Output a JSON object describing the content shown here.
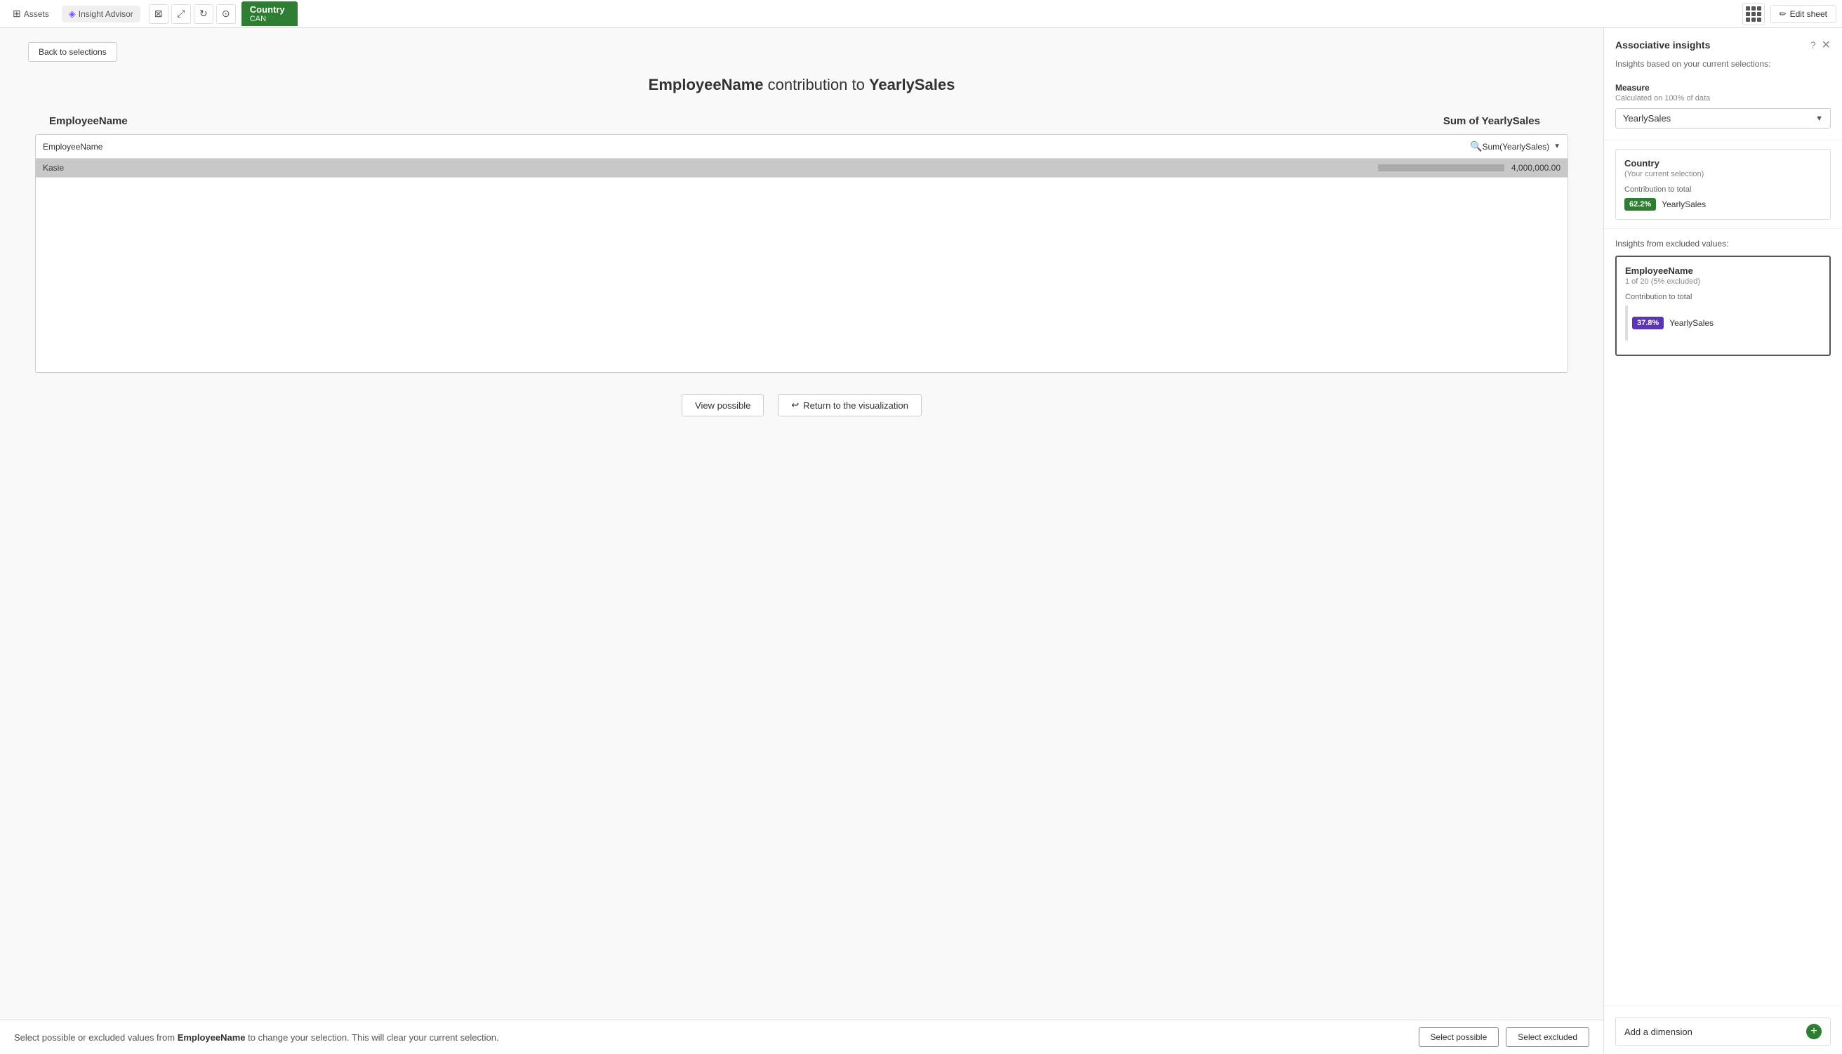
{
  "topbar": {
    "assets_label": "Assets",
    "insight_advisor_label": "Insight Advisor",
    "edit_sheet_label": "Edit sheet",
    "country_tab": {
      "label": "Country",
      "value": "CAN"
    }
  },
  "back_button": "Back to selections",
  "insight_title": {
    "dimension": "EmployeeName",
    "connector": " contribution to ",
    "measure": "YearlySales"
  },
  "table": {
    "col_employee": "EmployeeName",
    "col_sales": "Sum of YearlySales",
    "header_employee": "EmployeeName",
    "header_sales": "Sum(YearlySales)",
    "row_name": "Kasie",
    "row_value": "4,000,000.00"
  },
  "buttons": {
    "view_possible": "View possible",
    "return_to_visualization": "Return to the visualization"
  },
  "bottom_bar": {
    "text_prefix": "Select possible or excluded values from ",
    "field_name": "EmployeeName",
    "text_suffix": " to change your selection. This will clear your current selection.",
    "select_possible": "Select possible",
    "select_excluded": "Select excluded"
  },
  "sidebar": {
    "title": "Associative insights",
    "subtitle": "Insights based on your current selections:",
    "measure_label": "Measure",
    "measure_sublabel": "Calculated on 100% of data",
    "measure_value": "YearlySales",
    "current_selection": {
      "title": "Country",
      "subtitle": "(Your current selection)",
      "contribution_label": "Contribution to total",
      "badge": "62.2%",
      "field": "YearlySales"
    },
    "excluded_section_label": "Insights from excluded values:",
    "excluded_card": {
      "title": "EmployeeName",
      "subtitle": "1 of 20 (5% excluded)",
      "contribution_label": "Contribution to total",
      "badge": "37.8%",
      "field": "YearlySales"
    },
    "add_dimension": "Add a dimension"
  }
}
